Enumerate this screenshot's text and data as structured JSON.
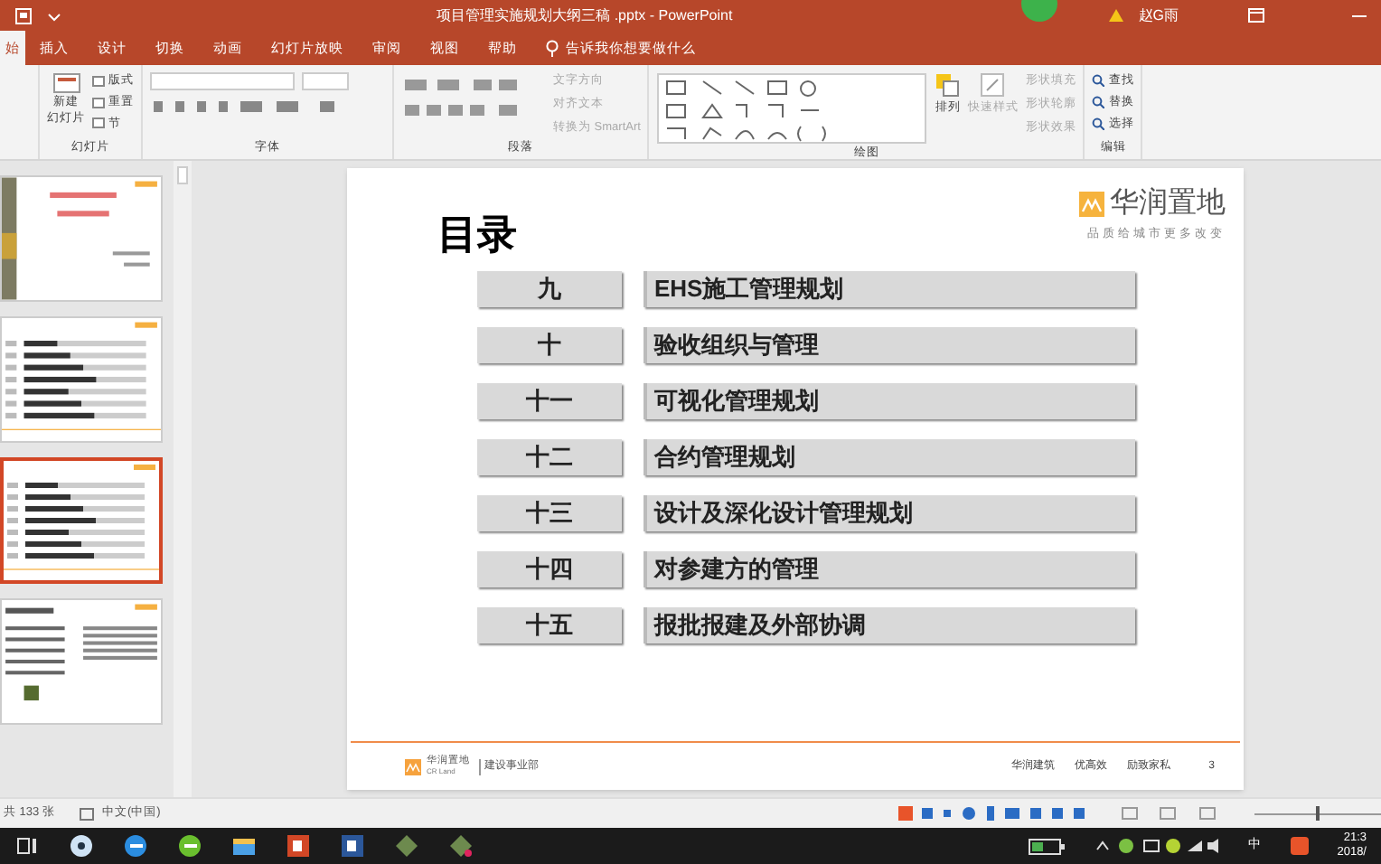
{
  "window": {
    "title": "项目管理实施规划大纲三稿 .pptx - PowerPoint",
    "user": "赵G雨"
  },
  "tabs": [
    {
      "label": "始",
      "selected": true
    },
    {
      "label": "插入",
      "selected": false
    },
    {
      "label": "设计",
      "selected": false
    },
    {
      "label": "切换",
      "selected": false
    },
    {
      "label": "动画",
      "selected": false
    },
    {
      "label": "幻灯片放映",
      "selected": false
    },
    {
      "label": "审阅",
      "selected": false
    },
    {
      "label": "视图",
      "selected": false
    },
    {
      "label": "帮助",
      "selected": false
    }
  ],
  "tell_me": {
    "placeholder": "告诉我你想要做什么"
  },
  "ribbon": {
    "slides_group": {
      "new_slide": [
        "新建",
        "幻灯片"
      ],
      "layout": "版式",
      "reset": "重置",
      "section": "节",
      "label": "幻灯片"
    },
    "font_group": {
      "label": "字体"
    },
    "paragraph_group": {
      "label": "段落",
      "text_direction": "文字方向",
      "align_text": "对齐文本",
      "smartart": "转换为 SmartArt"
    },
    "drawing_group": {
      "label": "绘图",
      "arrange": "排列",
      "quick_styles": "快速样式",
      "fill": "形状填充",
      "outline": "形状轮廓",
      "effects": "形状效果"
    },
    "editing_group": {
      "label": "编辑",
      "find": "查找",
      "replace": "替换",
      "select": "选择"
    }
  },
  "thumbnails": [
    {
      "selected": false,
      "kind": "cover"
    },
    {
      "selected": false,
      "kind": "toc"
    },
    {
      "selected": true,
      "kind": "toc"
    },
    {
      "selected": false,
      "kind": "text"
    }
  ],
  "slide": {
    "title": "目录",
    "logo_name": "华润置地",
    "logo_slogan": "品质给城市更多改变",
    "items": [
      {
        "number": "九",
        "topic": "EHS施工管理规划"
      },
      {
        "number": "十",
        "topic": "验收组织与管理"
      },
      {
        "number": "十一",
        "topic": "可视化管理规划"
      },
      {
        "number": "十二",
        "topic": "合约管理规划"
      },
      {
        "number": "十三",
        "topic": "设计及深化设计管理规划"
      },
      {
        "number": "十四",
        "topic": "对参建方的管理"
      },
      {
        "number": "十五",
        "topic": "报批报建及外部协调"
      }
    ],
    "footer": {
      "logo_name": "华润置地",
      "logo_sub": "CR Land",
      "dept": "建设事业部",
      "parts": [
        "华润建筑",
        "优高效",
        "励致家私"
      ],
      "page": "3"
    }
  },
  "status_bar": {
    "slide_count": "共 133 张",
    "language": "中文(中国)"
  },
  "zoom": {
    "level": 0.5
  },
  "taskbar": {
    "ime": "中",
    "time": "21:3",
    "date": "2018/"
  }
}
